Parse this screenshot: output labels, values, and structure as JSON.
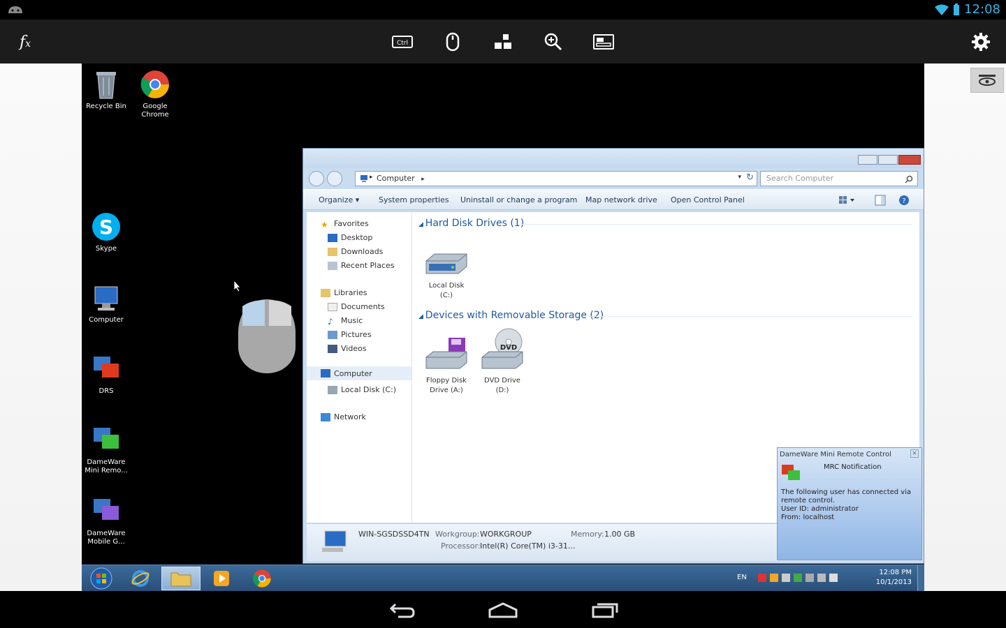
{
  "status_bar": {
    "time": "12:08",
    "left_icon": "android-debug-icon"
  },
  "toolbar": {
    "buttons": [
      {
        "name": "function-keys",
        "icon": "fx-icon"
      },
      {
        "name": "keyboard",
        "icon": "keyboard-icon"
      },
      {
        "name": "mouse",
        "icon": "mouse-icon"
      },
      {
        "name": "monitors",
        "icon": "monitors-icon"
      },
      {
        "name": "zoom",
        "icon": "zoom-icon"
      },
      {
        "name": "screen",
        "icon": "screen-icon"
      },
      {
        "name": "settings",
        "icon": "gear-icon"
      }
    ],
    "keyboard_label": "Ctrl"
  },
  "desktop": {
    "icons": [
      {
        "label": "Recycle Bin"
      },
      {
        "label": "Google Chrome"
      },
      {
        "label": "Skype"
      },
      {
        "label": "Computer"
      },
      {
        "label": "DRS"
      },
      {
        "label": "DameWare Mini Remo..."
      },
      {
        "label": "DameWare Mobile G..."
      }
    ]
  },
  "explorer": {
    "address": "Computer",
    "address_sep": "▸",
    "search_placeholder": "Search Computer",
    "commands": [
      "Organize ▾",
      "System properties",
      "Uninstall or change a program",
      "Map network drive",
      "Open Control Panel"
    ],
    "nav": {
      "favorites": "Favorites",
      "desktop": "Desktop",
      "downloads": "Downloads",
      "recent": "Recent Places",
      "libraries": "Libraries",
      "documents": "Documents",
      "music": "Music",
      "pictures": "Pictures",
      "videos": "Videos",
      "computer": "Computer",
      "local_disk": "Local Disk (C:)",
      "network": "Network"
    },
    "groups": {
      "hdd": "Hard Disk Drives (1)",
      "removable": "Devices with Removable Storage (2)"
    },
    "drives": {
      "c_line1": "Local Disk",
      "c_line2": "(C:)",
      "floppy_line1": "Floppy Disk",
      "floppy_line2": "Drive (A:)",
      "dvd_line1": "DVD Drive",
      "dvd_line2": "(D:)",
      "dvd_text": "DVD"
    },
    "details": {
      "machine": "WIN-SGSDSSD4TN",
      "workgroup_label": "Workgroup:",
      "workgroup": "WORKGROUP",
      "memory_label": "Memory:",
      "memory": "1.00 GB",
      "processor_label": "Processor:",
      "processor": "Intel(R) Core(TM) i3-31..."
    }
  },
  "notification": {
    "title": "DameWare Mini Remote Control",
    "subtitle": "MRC Notification",
    "line1": "The following user has connected via",
    "line2": "remote control.",
    "line3": "User ID: administrator",
    "line4": "From: localhost"
  },
  "taskbar": {
    "time": "12:08 PM",
    "date": "10/1/2013",
    "lang": "EN"
  }
}
